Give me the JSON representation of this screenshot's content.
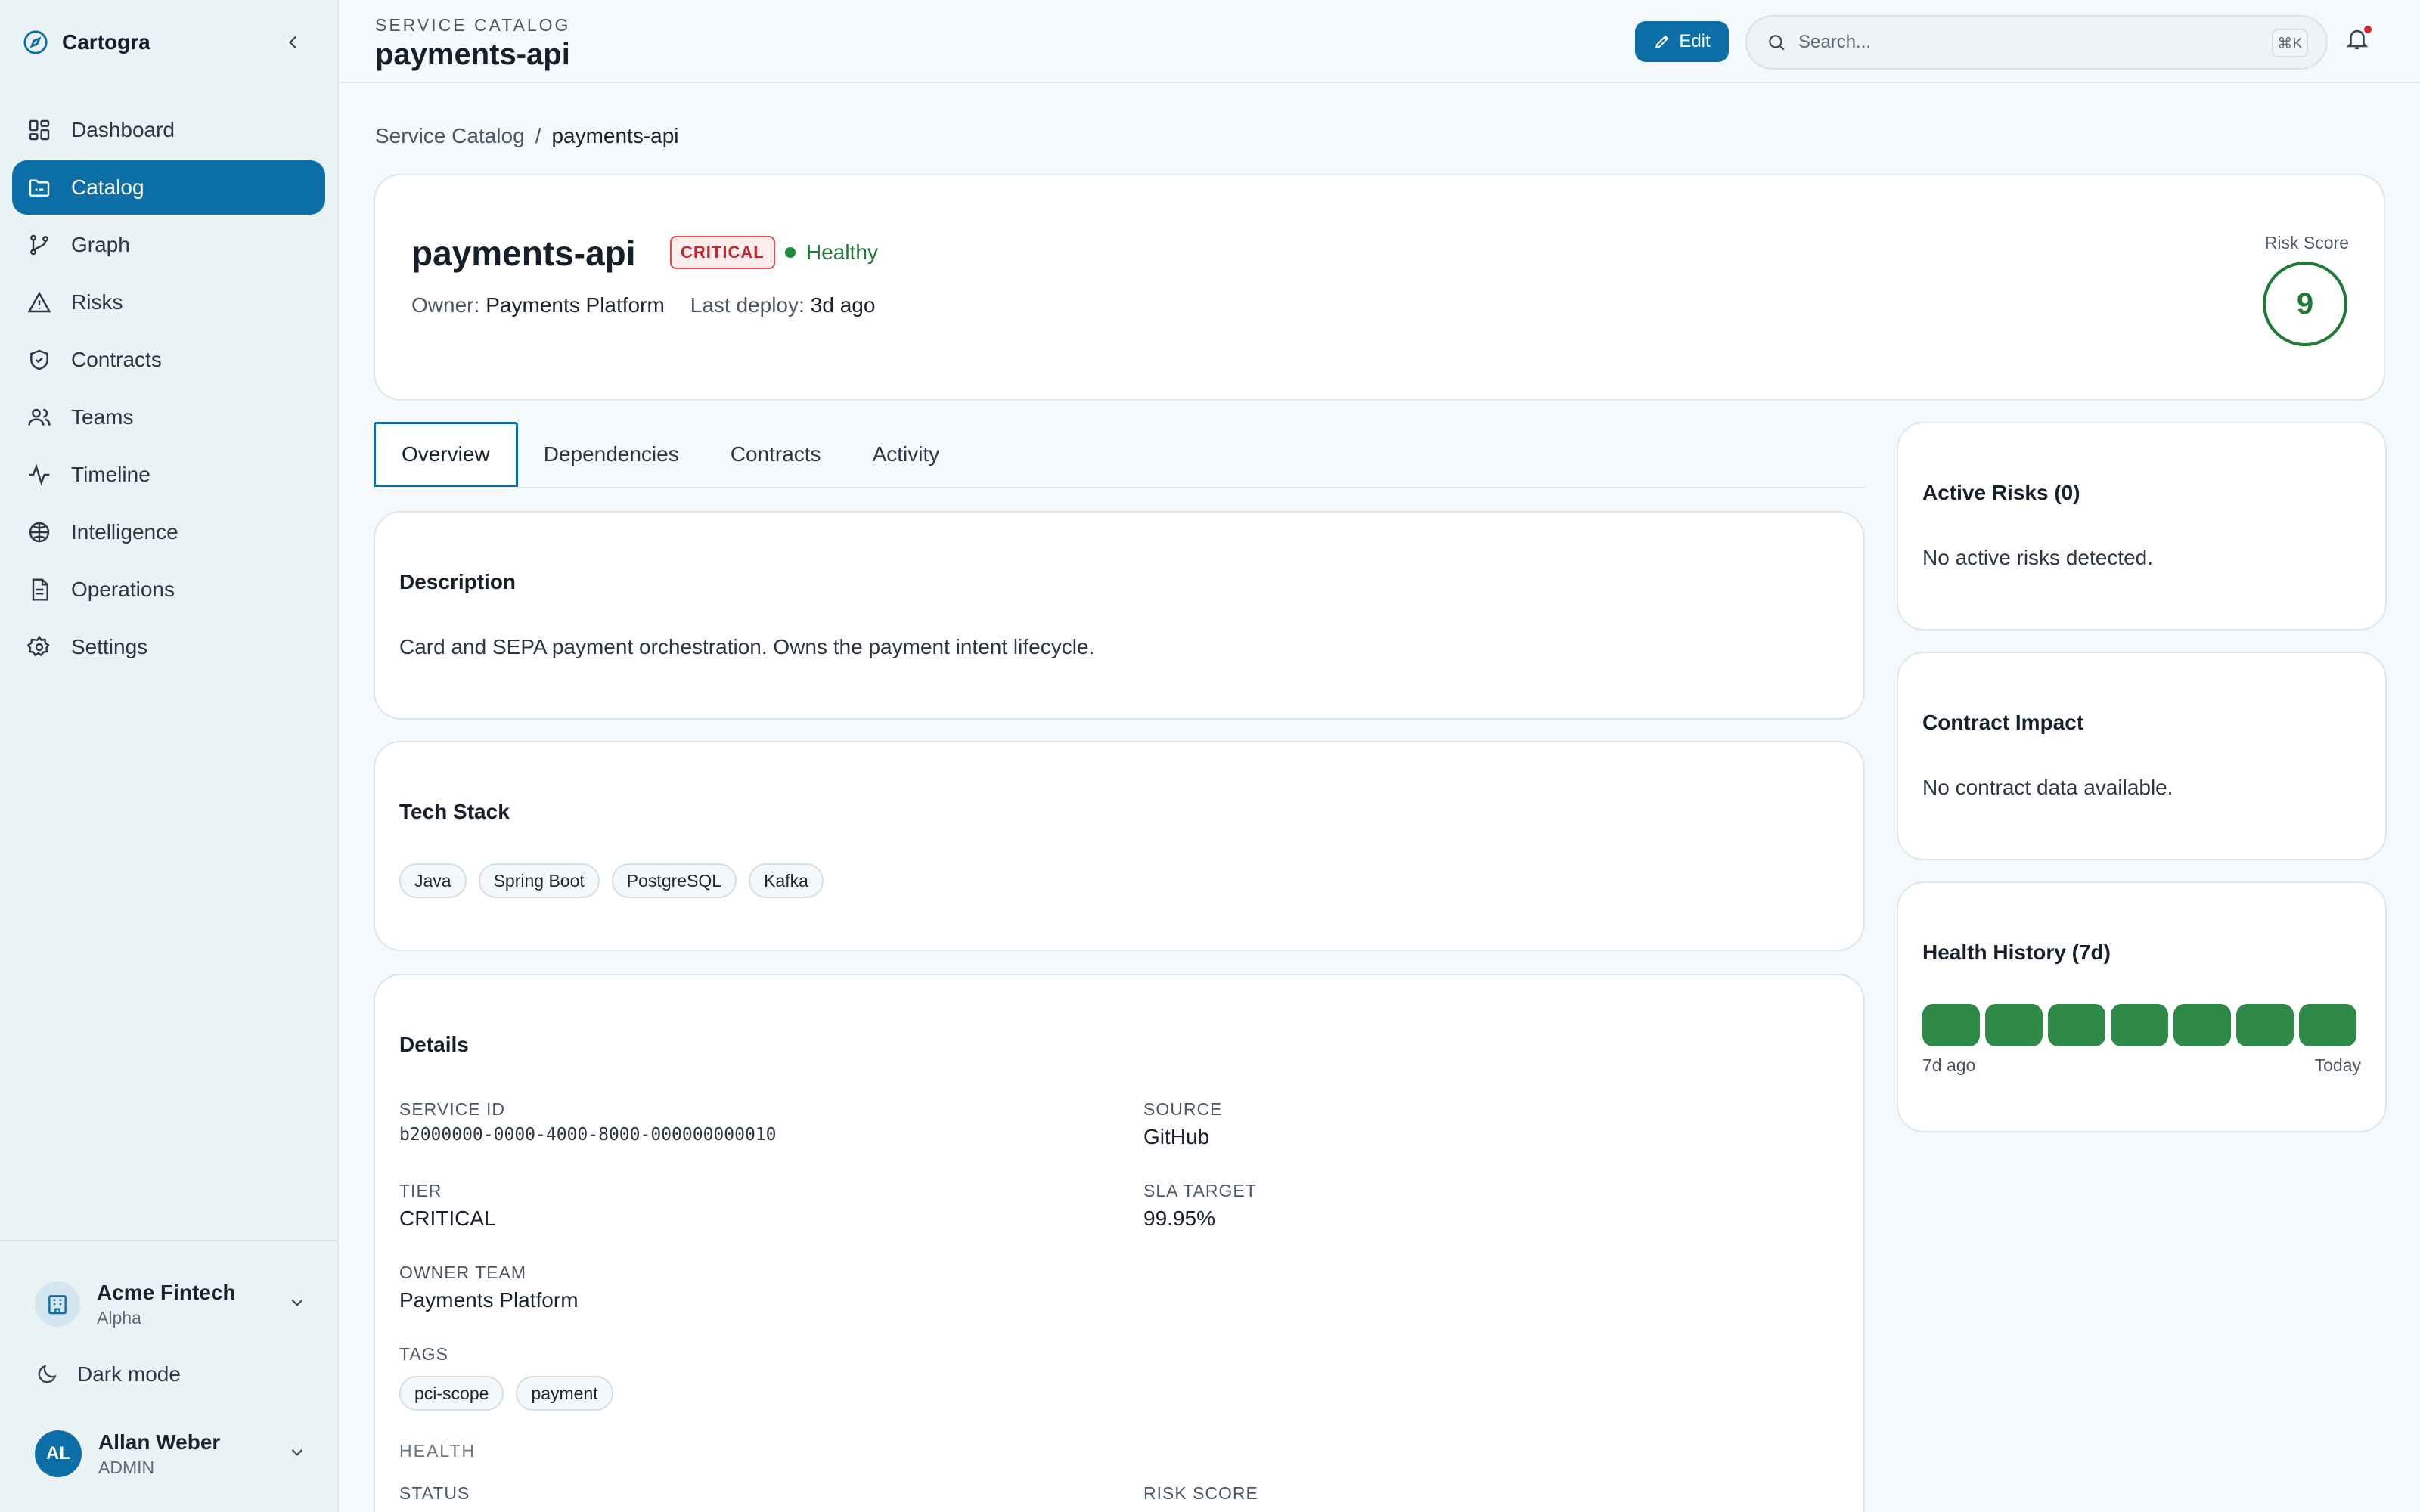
{
  "app": {
    "name": "Cartogra"
  },
  "sidebar": {
    "items": [
      {
        "label": "Dashboard",
        "icon": "grid-icon"
      },
      {
        "label": "Catalog",
        "icon": "folder-icon"
      },
      {
        "label": "Graph",
        "icon": "git-branch-icon"
      },
      {
        "label": "Risks",
        "icon": "warning-icon"
      },
      {
        "label": "Contracts",
        "icon": "shield-icon"
      },
      {
        "label": "Teams",
        "icon": "users-icon"
      },
      {
        "label": "Timeline",
        "icon": "activity-icon"
      },
      {
        "label": "Intelligence",
        "icon": "brain-icon"
      },
      {
        "label": "Operations",
        "icon": "document-icon"
      },
      {
        "label": "Settings",
        "icon": "gear-icon"
      }
    ],
    "active_index": 1,
    "org": {
      "name": "Acme Fintech",
      "plan": "Alpha"
    },
    "dark_mode_label": "Dark mode",
    "user": {
      "initials": "AL",
      "name": "Allan Weber",
      "role": "ADMIN"
    }
  },
  "header": {
    "eyebrow": "SERVICE CATALOG",
    "title": "payments-api",
    "edit_label": "Edit",
    "search_placeholder": "Search...",
    "search_shortcut": "⌘K"
  },
  "breadcrumb": {
    "root": "Service Catalog",
    "sep": "/",
    "current": "payments-api"
  },
  "service": {
    "name": "payments-api",
    "tier_badge": "CRITICAL",
    "health": "Healthy",
    "owner_label": "Owner:",
    "owner": "Payments Platform",
    "deploy_label": "Last deploy:",
    "deploy": "3d ago",
    "risk_label": "Risk Score",
    "risk_score": "9"
  },
  "tabs": [
    "Overview",
    "Dependencies",
    "Contracts",
    "Activity"
  ],
  "active_tab": 0,
  "description": {
    "title": "Description",
    "text": "Card and SEPA payment orchestration. Owns the payment intent lifecycle."
  },
  "tech_stack": {
    "title": "Tech Stack",
    "items": [
      "Java",
      "Spring Boot",
      "PostgreSQL",
      "Kafka"
    ]
  },
  "details": {
    "title": "Details",
    "service_id_label": "SERVICE ID",
    "service_id": "b2000000-0000-4000-8000-000000000010",
    "source_label": "SOURCE",
    "source": "GitHub",
    "tier_label": "TIER",
    "tier": "CRITICAL",
    "sla_label": "SLA TARGET",
    "sla": "99.95%",
    "owner_team_label": "OWNER TEAM",
    "owner_team": "Payments Platform",
    "tags_label": "TAGS",
    "tags": [
      "pci-scope",
      "payment"
    ],
    "health_section": "HEALTH",
    "status_label": "STATUS",
    "risk_score_label": "RISK SCORE"
  },
  "active_risks": {
    "title": "Active Risks (0)",
    "text": "No active risks detected."
  },
  "contract_impact": {
    "title": "Contract Impact",
    "text": "No contract data available."
  },
  "health_history": {
    "title": "Health History (7d)",
    "days": [
      "healthy",
      "healthy",
      "healthy",
      "healthy",
      "healthy",
      "healthy",
      "healthy"
    ],
    "start_label": "7d ago",
    "end_label": "Today"
  },
  "colors": {
    "accent": "#0c6ea6",
    "healthy": "#2f8a48",
    "critical": "#c4262b"
  }
}
